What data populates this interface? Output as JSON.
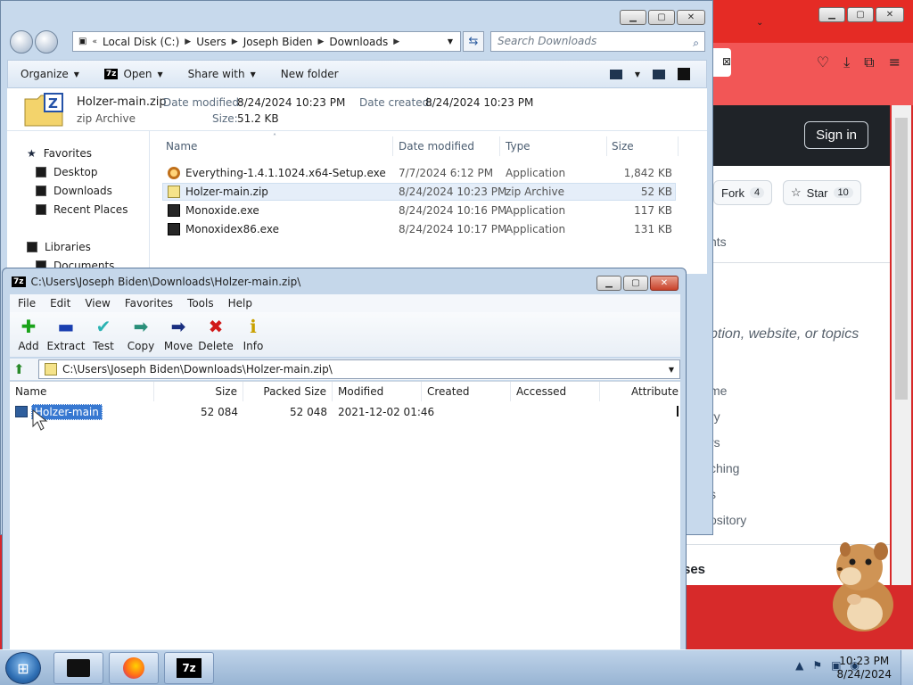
{
  "browser": {
    "sign_in": "Sign in",
    "fork_label": "Fork",
    "fork_count": "4",
    "star_label": "Star",
    "star_count": "10",
    "text_fragments": [
      "nts",
      "ption, website, or topics",
      "me",
      "ry",
      "rs",
      "ching",
      "s",
      "ository",
      "ses"
    ]
  },
  "explorer": {
    "breadcrumb": [
      "Local Disk (C:)",
      "Users",
      "Joseph Biden",
      "Downloads"
    ],
    "search_placeholder": "Search Downloads",
    "toolbar": {
      "organize": "Organize",
      "open": "Open",
      "share_with": "Share with",
      "new_folder": "New folder"
    },
    "details": {
      "name": "Holzer-main.zip",
      "type": "zip Archive",
      "modified_label": "Date modified:",
      "modified": "8/24/2024 10:23 PM",
      "created_label": "Date created:",
      "created": "8/24/2024 10:23 PM",
      "size_label": "Size:",
      "size": "51.2 KB"
    },
    "nav": [
      "Favorites",
      "Desktop",
      "Downloads",
      "Recent Places",
      "Libraries",
      "Documents"
    ],
    "columns": [
      "Name",
      "Date modified",
      "Type",
      "Size"
    ],
    "files": [
      {
        "name": "Everything-1.4.1.1024.x64-Setup.exe",
        "modified": "7/7/2024 6:12 PM",
        "type": "Application",
        "size": "1,842 KB",
        "icon": "key"
      },
      {
        "name": "Holzer-main.zip",
        "modified": "8/24/2024 10:23 PM",
        "type": "zip Archive",
        "size": "52 KB",
        "icon": "zip"
      },
      {
        "name": "Monoxide.exe",
        "modified": "8/24/2024 10:16 PM",
        "type": "Application",
        "size": "117 KB",
        "icon": "app"
      },
      {
        "name": "Monoxidex86.exe",
        "modified": "8/24/2024 10:17 PM",
        "type": "Application",
        "size": "131 KB",
        "icon": "app"
      }
    ]
  },
  "sevenzip": {
    "title": "C:\\Users\\Joseph Biden\\Downloads\\Holzer-main.zip\\",
    "menu": [
      "File",
      "Edit",
      "View",
      "Favorites",
      "Tools",
      "Help"
    ],
    "tools": [
      {
        "label": "Add",
        "glyph": "✚",
        "color": "#1aa31a"
      },
      {
        "label": "Extract",
        "glyph": "▬",
        "color": "#1a3fb0"
      },
      {
        "label": "Test",
        "glyph": "✔",
        "color": "#2bb3b3"
      },
      {
        "label": "Copy",
        "glyph": "➡",
        "color": "#2a8f7a"
      },
      {
        "label": "Move",
        "glyph": "➡",
        "color": "#1a2f80"
      },
      {
        "label": "Delete",
        "glyph": "✖",
        "color": "#d01818"
      },
      {
        "label": "Info",
        "glyph": "ℹ",
        "color": "#c9a100"
      }
    ],
    "path": "C:\\Users\\Joseph Biden\\Downloads\\Holzer-main.zip\\",
    "columns": [
      "Name",
      "Size",
      "Packed Size",
      "Modified",
      "Created",
      "Accessed",
      "Attribute"
    ],
    "rows": [
      {
        "name": "Holzer-main",
        "size": "52 084",
        "packed": "52 048",
        "modified": "2021-12-02 01:46",
        "created": "",
        "accessed": ""
      }
    ]
  },
  "taskbar": {
    "time": "10:23 PM",
    "date": "8/24/2024",
    "sevenzip_label": "7z"
  }
}
